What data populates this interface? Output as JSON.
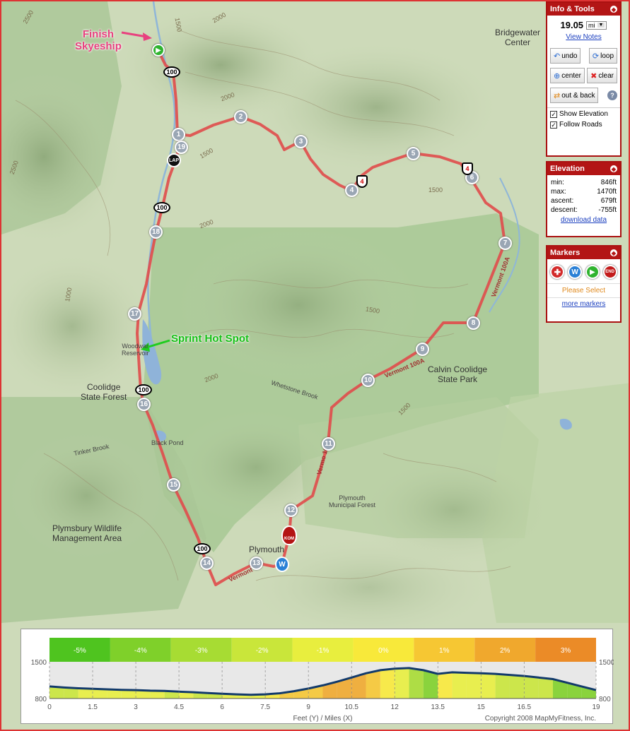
{
  "callouts": {
    "finish": "Finish\nSkyeship",
    "sprint": "Sprint Hot Spot"
  },
  "places": {
    "bridgewater": "Bridgewater\nCenter",
    "coolidge_forest": "Coolidge\nState Forest",
    "calvin_park": "Calvin Coolidge\nState Park",
    "woodward": "Woodwar\nReservoir",
    "whetstone": "Whetstone Brook",
    "black_pond": "Black Pond",
    "tinker": "Tinker Brook",
    "plymsbury": "Plymsbury Wildlife\nManagement Area",
    "plymouth": "Plymouth",
    "plymouth_forest": "Plymouth\nMunicipal Forest",
    "vt100a_a": "Vermont 100A",
    "vt100a_b": "Vermont 100A",
    "vt100a_c": "Vermo 100A",
    "vt4": "Vermont 4"
  },
  "contours": {
    "c2500a": "2500",
    "c2000a": "2000",
    "c1500a": "1500",
    "c2000b": "2000",
    "c2500b": "2500",
    "c1500b": "1500",
    "c1000a": "1000",
    "c2000c": "2000",
    "c1500c": "1500",
    "c1500d": "1500",
    "c2000d": "2000",
    "c1500e": "1500"
  },
  "route": {
    "markers": [
      "1",
      "2",
      "3",
      "4",
      "5",
      "6",
      "7",
      "8",
      "9",
      "10",
      "11",
      "12",
      "13",
      "14",
      "15",
      "16",
      "17",
      "18",
      "19"
    ],
    "shields": [
      "100",
      "100",
      "100",
      "100"
    ],
    "vt_shields": [
      "4",
      "4"
    ],
    "lap": "LAP",
    "kom": "KOM",
    "water": "W"
  },
  "info_tools": {
    "title": "Info & Tools",
    "distance": "19.05",
    "unit": "mi",
    "view_notes": "View Notes",
    "undo": "undo",
    "loop": "loop",
    "center": "center",
    "clear": "clear",
    "out_back": "out & back",
    "help": "?",
    "show_elevation": "Show Elevation",
    "follow_roads": "Follow Roads"
  },
  "elevation": {
    "title": "Elevation",
    "min_label": "min:",
    "min": "846ft",
    "max_label": "max:",
    "max": "1470ft",
    "ascent_label": "ascent:",
    "ascent": "679ft",
    "descent_label": "descent:",
    "descent": "-755ft",
    "download": "download data"
  },
  "markers": {
    "title": "Markers",
    "please_select": "Please Select",
    "more": "more markers",
    "icons": [
      "add-marker-icon",
      "water-marker-icon",
      "start-marker-icon",
      "end-marker-icon"
    ],
    "end_label": "END"
  },
  "chart_data": {
    "type": "area",
    "title": "",
    "xlabel": "Feet (Y) / Miles (X)",
    "ylabel": "",
    "x_ticks": [
      "0",
      "1.5",
      "3",
      "4.5",
      "6",
      "7.5",
      "9",
      "10.5",
      "12",
      "13.5",
      "15",
      "16.5",
      "19"
    ],
    "y_ticks_left": [
      "1500",
      "800"
    ],
    "y_ticks_right": [
      "1500",
      "800"
    ],
    "xlim": [
      0,
      19
    ],
    "ylim": [
      800,
      1500
    ],
    "grade_legend": [
      "-5%",
      "-4%",
      "-3%",
      "-2%",
      "-1%",
      "0%",
      "1%",
      "2%",
      "3%"
    ],
    "grade_colors": [
      "#4fc41f",
      "#7fd02a",
      "#a7dc33",
      "#c9e63a",
      "#e8ee3e",
      "#f8e93a",
      "#f6c733",
      "#f0a82d",
      "#eb8b27"
    ],
    "series": [
      {
        "x": [
          0,
          0.5,
          1,
          1.5,
          2,
          2.5,
          3,
          3.5,
          4,
          4.5,
          5,
          5.5,
          6,
          6.5,
          7,
          7.5,
          8,
          8.5,
          9,
          9.5,
          10,
          10.5,
          11,
          11.5,
          12,
          12.5,
          13,
          13.5,
          14,
          14.5,
          15,
          15.5,
          16,
          16.5,
          17,
          17.5,
          18,
          18.5,
          19
        ],
        "y": [
          1030,
          1010,
          995,
          985,
          975,
          965,
          960,
          950,
          945,
          930,
          920,
          905,
          890,
          880,
          870,
          880,
          900,
          940,
          990,
          1050,
          1120,
          1200,
          1280,
          1340,
          1370,
          1380,
          1340,
          1270,
          1300,
          1290,
          1280,
          1270,
          1250,
          1230,
          1200,
          1170,
          1100,
          1030,
          960
        ]
      }
    ],
    "credit": "Copyright 2008 MapMyFitness, Inc."
  }
}
